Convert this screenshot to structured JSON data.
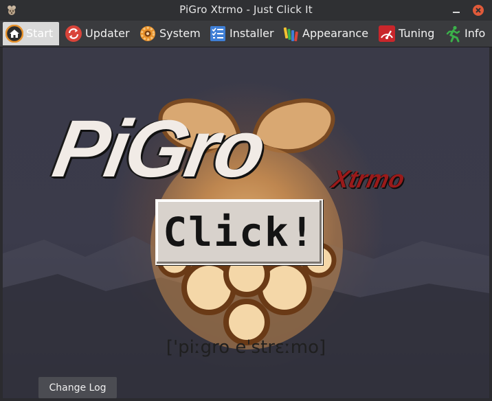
{
  "window": {
    "title": "PiGro Xtrmo - Just Click It",
    "app_icon": "raspberry-icon",
    "controls": [
      "minimize-icon",
      "close-icon"
    ],
    "close_color": "#e05a3a"
  },
  "tabs": [
    {
      "label": "Start",
      "icon": "home-icon",
      "active": true
    },
    {
      "label": "Updater",
      "icon": "refresh-icon",
      "active": false
    },
    {
      "label": "System",
      "icon": "gear-icon",
      "active": false
    },
    {
      "label": "Installer",
      "icon": "checklist-icon",
      "active": false
    },
    {
      "label": "Appearance",
      "icon": "paint-icon",
      "active": false
    },
    {
      "label": "Tuning",
      "icon": "gauge-icon",
      "active": false
    },
    {
      "label": "Info",
      "icon": "running-man-icon",
      "active": false
    }
  ],
  "start": {
    "logo_main": "PiGro",
    "logo_sub": "Xtrmo",
    "click_button": "Click!",
    "phonetic": "['piːgro eˈstrɛːmo]",
    "changelog_button": "Change Log"
  },
  "colors": {
    "accent_orange": "#e8912a",
    "logo_red": "#9a1a1a",
    "glow": "#ffd696"
  }
}
